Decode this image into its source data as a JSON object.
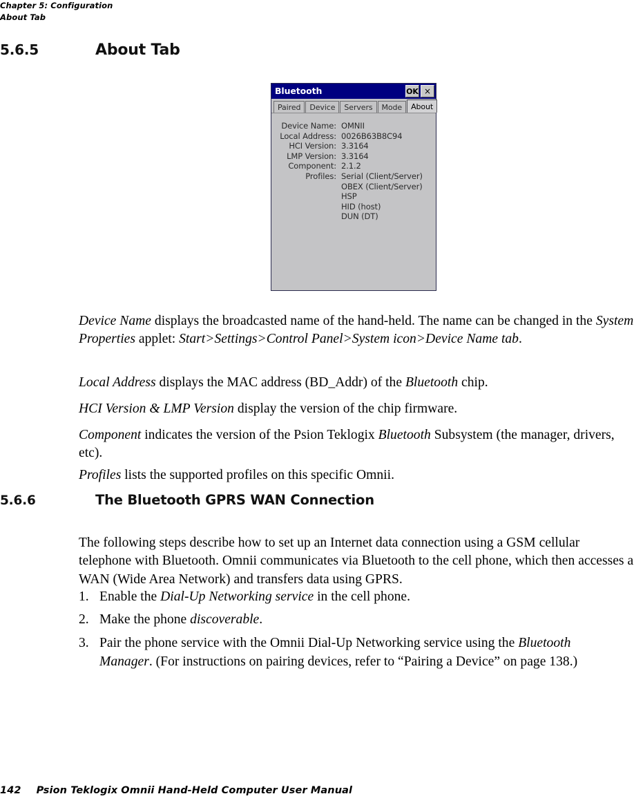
{
  "header": {
    "chapter_line": "Chapter 5:  Configuration",
    "section_line": "About Tab"
  },
  "sections": {
    "about_tab": {
      "number": "5.6.5",
      "title": "About Tab"
    },
    "gprs": {
      "number": "5.6.6",
      "title": "The Bluetooth GPRS WAN Connection"
    }
  },
  "figure": {
    "window_title": "Bluetooth",
    "buttons": {
      "ok": "OK",
      "close": "×"
    },
    "tabs": [
      {
        "label": "Paired",
        "active": false
      },
      {
        "label": "Device",
        "active": false
      },
      {
        "label": "Servers",
        "active": false
      },
      {
        "label": "Mode",
        "active": false
      },
      {
        "label": "About",
        "active": true
      }
    ],
    "fields": [
      {
        "label": "Device Name:",
        "value": "OMNII"
      },
      {
        "label": "Local Address:",
        "value": "0026B63B8C94"
      },
      {
        "label": "HCI Version:",
        "value": "3.3164"
      },
      {
        "label": "LMP Version:",
        "value": "3.3164"
      },
      {
        "label": "Component:",
        "value": "2.1.2"
      }
    ],
    "profiles_label": "Profiles:",
    "profiles": [
      "Serial (Client/Server)",
      "OBEX (Client/Server)",
      "HSP",
      "HID (host)",
      "DUN (DT)"
    ],
    "colors": {
      "titlebar": "#000080",
      "window_bg": "#c4c4c6",
      "tab_border": "#6e6e70"
    }
  },
  "body": {
    "device_name": {
      "term": "Device Name",
      "text_1": " displays the broadcasted name of the hand-held. The name can be changed in the ",
      "term_2": "System Properties",
      "text_2": " applet: ",
      "path": "Start>Settings>Control Panel>System icon>Device Name tab",
      "text_3": "."
    },
    "local_address": {
      "term": "Local Address",
      "text_1": " displays the MAC address (BD_Addr) of the ",
      "term_2": "Bluetooth",
      "text_2": " chip."
    },
    "versions": {
      "term": "HCI Version & LMP Version",
      "text_1": " display the version of the chip firmware."
    },
    "component": {
      "term": "Component",
      "text_1": " indicates the version of the Psion Teklogix ",
      "term_2": "Bluetooth",
      "text_2": " Subsystem (the manager, drivers, etc)."
    },
    "profiles": {
      "term": "Profiles",
      "text_1": " lists the supported profiles on this specific Omnii."
    },
    "gprs_intro": "The following steps describe how to set up an Internet data connection using a GSM cellular telephone with Bluetooth. Omnii communicates via Bluetooth to the cell phone, which then accesses a WAN (Wide Area Network) and transfers data using GPRS.",
    "steps": [
      {
        "marker": "1.",
        "text_1": "Enable the ",
        "em_1": "Dial-Up Networking service",
        "text_2": " in the cell phone."
      },
      {
        "marker": "2.",
        "text_1": "Make the phone ",
        "em_1": "discoverable",
        "text_2": "."
      },
      {
        "marker": "3.",
        "text_1": "Pair the phone service with the Omnii Dial-Up Networking service using the ",
        "em_1": "Bluetooth Manager",
        "text_2": ". (For instructions on pairing devices, refer to “Pairing a Device” on page 138.)"
      }
    ]
  },
  "footer": {
    "page_number": "142",
    "manual_title": "Psion Teklogix Omnii Hand-Held Computer User Manual"
  }
}
